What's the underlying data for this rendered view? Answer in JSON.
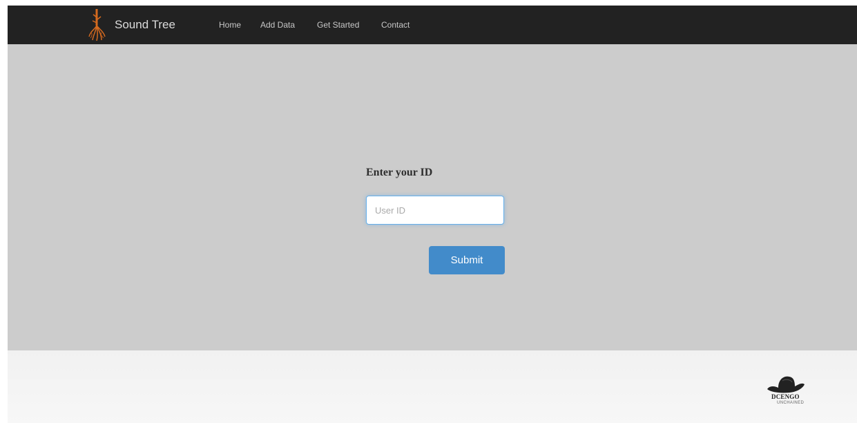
{
  "navbar": {
    "brand_name": "Sound Tree",
    "brand_icon": "tree-roots-icon",
    "links": [
      {
        "label": "Home"
      },
      {
        "label": "Add Data"
      },
      {
        "label": "Get Started"
      },
      {
        "label": "Contact"
      }
    ]
  },
  "form": {
    "title": "Enter your ID",
    "user_id_placeholder": "User ID",
    "user_id_value": "",
    "submit_label": "Submit"
  },
  "footer": {
    "logo_icon": "cowboy-hat-icon",
    "logo_name": "DCENGO",
    "logo_sub": "UNCHAINED"
  },
  "colors": {
    "navbar_bg": "#222222",
    "hero_bg": "#cccccc",
    "button_bg": "#428bca",
    "input_focus_border": "#66afe9",
    "logo_orange": "#d46a1f"
  }
}
